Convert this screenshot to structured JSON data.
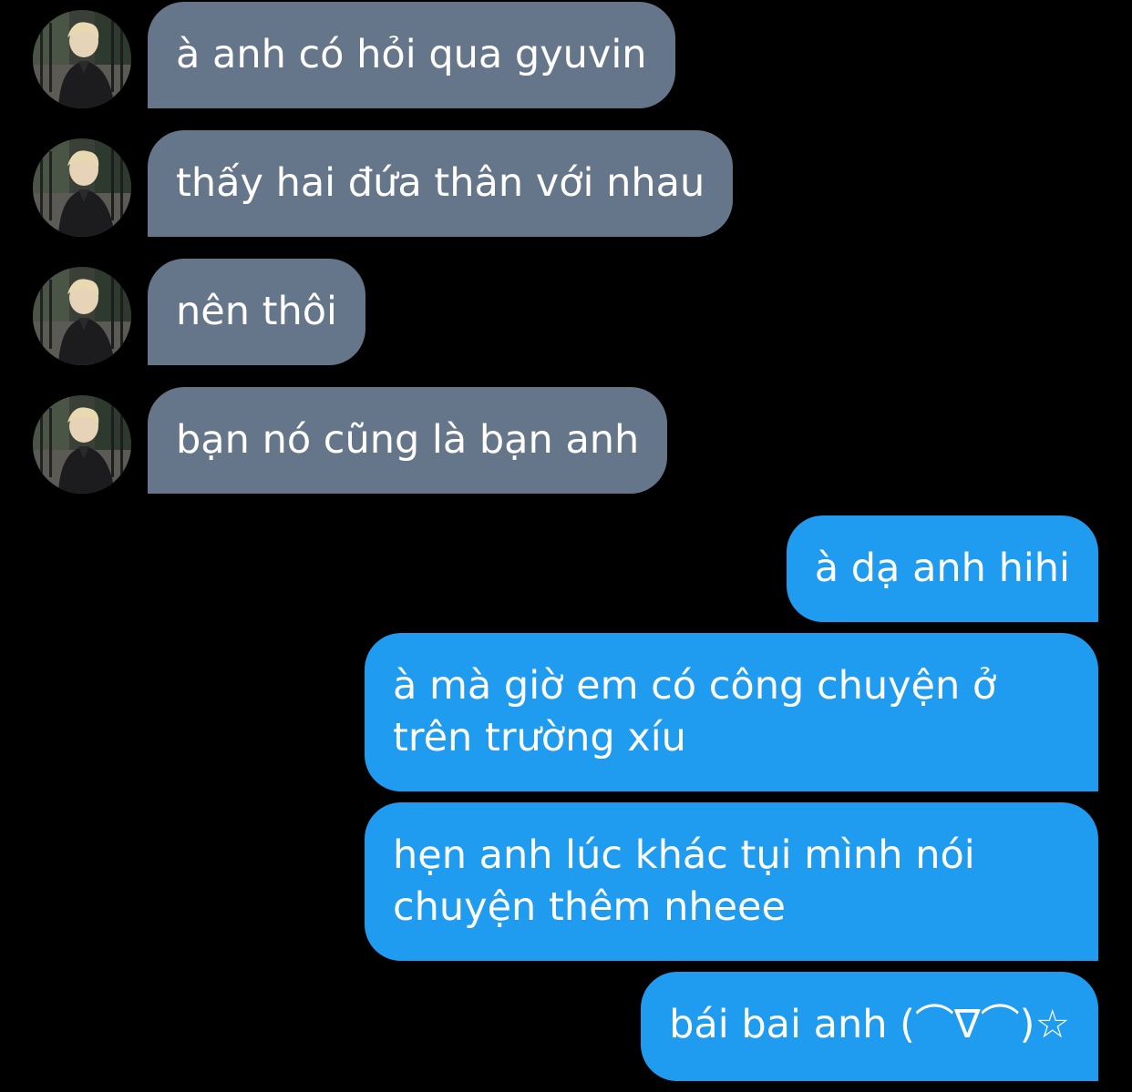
{
  "conversation": {
    "contact": {
      "avatar_icon": "profile-photo-icon"
    },
    "messages": [
      {
        "from": "them",
        "text": "à anh có hỏi qua gyuvin"
      },
      {
        "from": "them",
        "text": "thấy hai đứa thân với nhau"
      },
      {
        "from": "them",
        "text": "nên thôi"
      },
      {
        "from": "them",
        "text": "bạn nó cũng là bạn anh"
      },
      {
        "from": "me",
        "text": "à dạ anh hihi"
      },
      {
        "from": "me",
        "lines": [
          "à mà giờ em có công chuyện ở",
          "trên trường xíu"
        ]
      },
      {
        "from": "me",
        "lines": [
          "hẹn anh lúc khác tụi mình nói",
          "chuyện thêm nheee"
        ]
      },
      {
        "from": "me",
        "text": "bái bai anh (⌒∇⌒)☆"
      }
    ],
    "colors": {
      "background": "#000000",
      "incoming_bubble": "#66768a",
      "outgoing_bubble": "#1f9cf0",
      "text": "#ffffff"
    }
  }
}
